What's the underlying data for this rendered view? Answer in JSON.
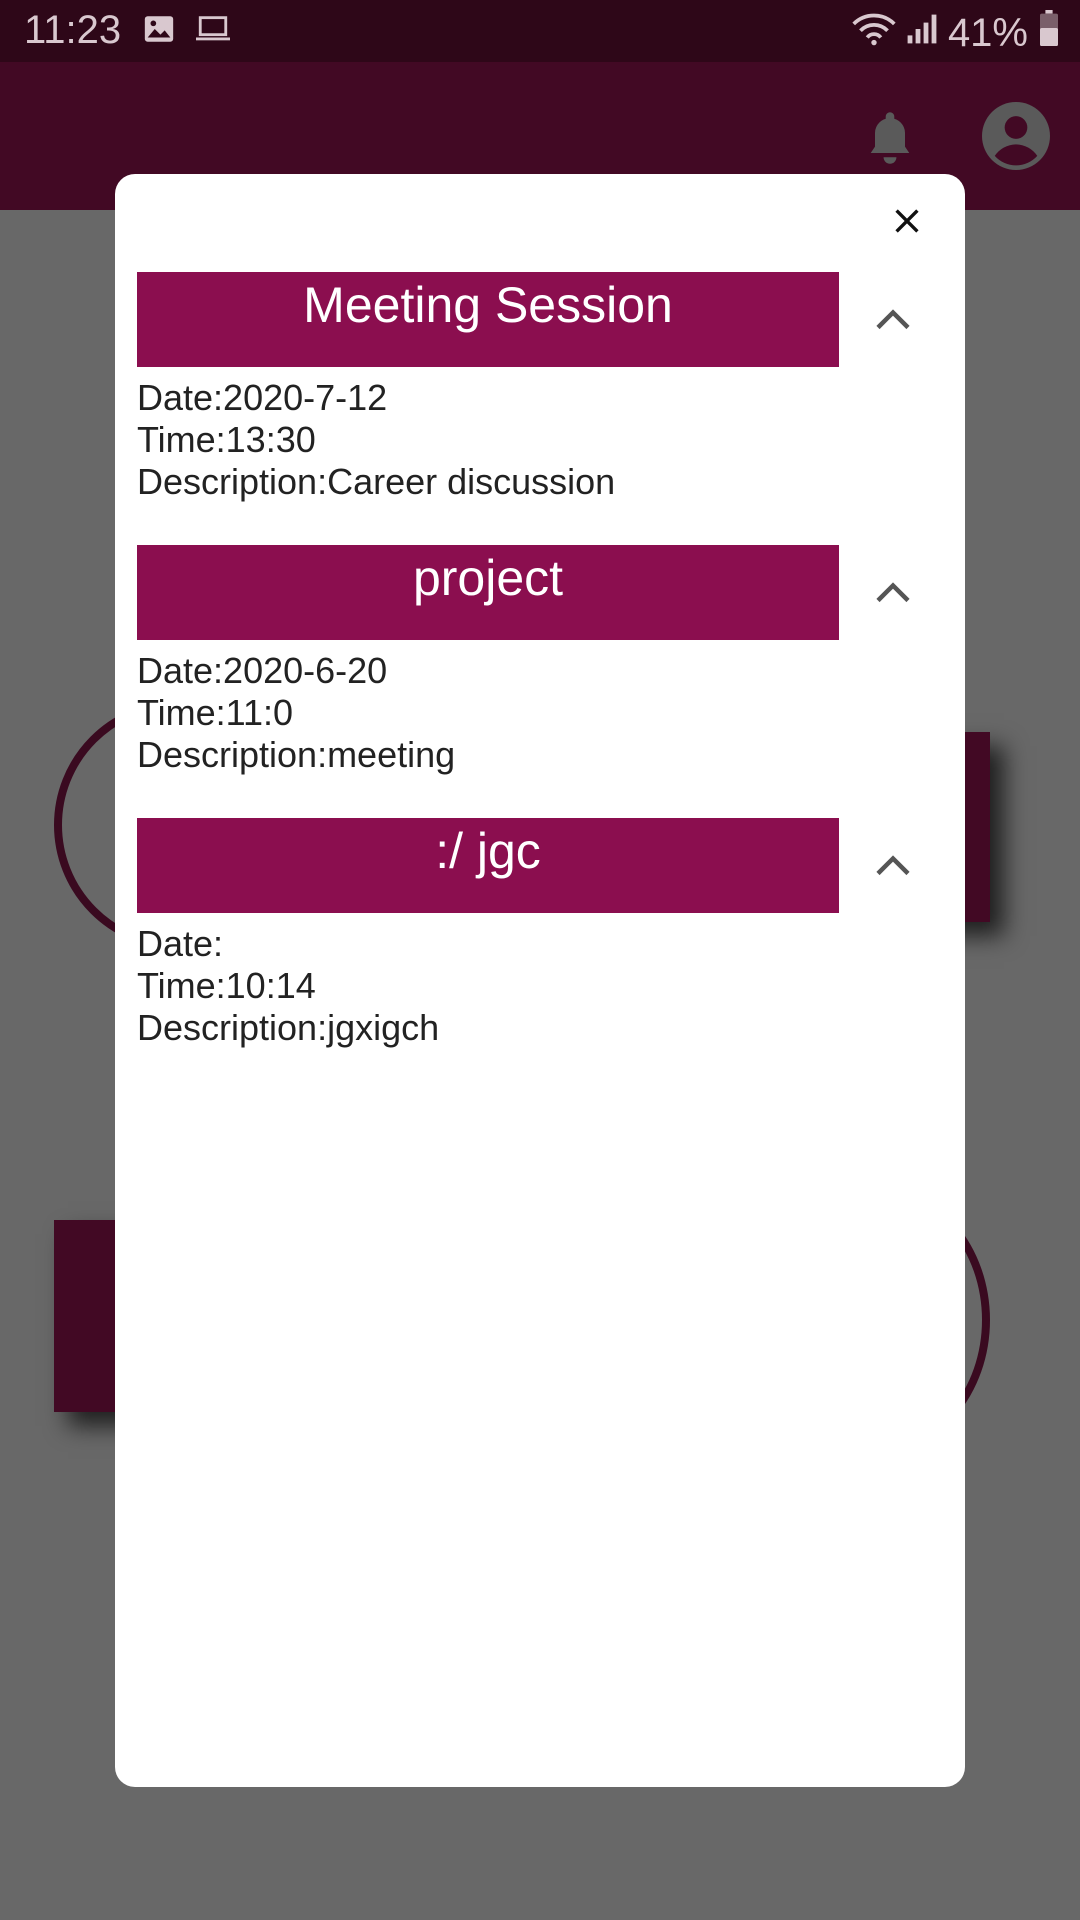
{
  "status_bar": {
    "time": "11:23",
    "battery": "41%"
  },
  "dialog": {
    "events": [
      {
        "title": "Meeting Session",
        "date_label": "Date:2020-7-12",
        "time_label": "Time:13:30",
        "description_label": "Description:Career discussion"
      },
      {
        "title": "project",
        "date_label": "Date:2020-6-20",
        "time_label": "Time:11:0",
        "description_label": "Description:meeting"
      },
      {
        "title": ":/ jgc",
        "date_label": "Date:",
        "time_label": "Time:10:14",
        "description_label": "Description:jgxigch"
      }
    ]
  },
  "colors": {
    "primary": "#8b0e4f",
    "app_bar": "#420924",
    "status_bar": "#2e0718",
    "scrim": "#686868"
  },
  "icons": [
    "image-icon",
    "laptop-icon",
    "wifi-icon",
    "signal-icon",
    "battery-icon",
    "bell-icon",
    "account-icon",
    "close-icon",
    "chevron-up-icon"
  ]
}
